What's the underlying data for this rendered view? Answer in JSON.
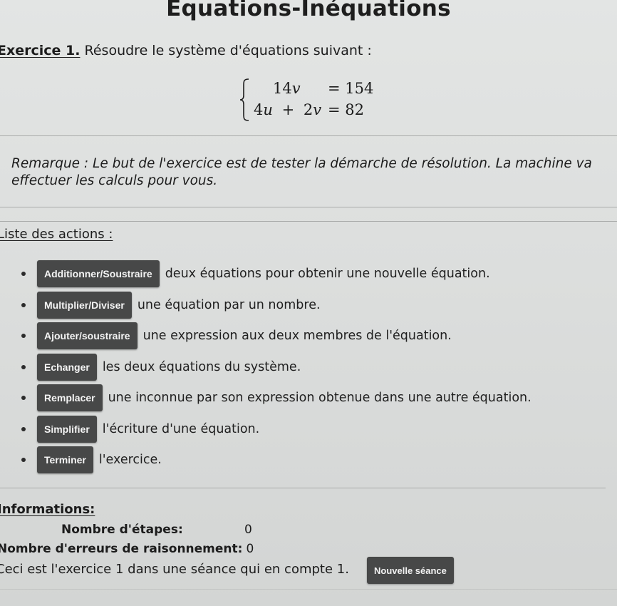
{
  "page": {
    "title": "Equations-Inéquations"
  },
  "exercise": {
    "label": "Exercice 1.",
    "instruction": "Résoudre le système d'équations suivant :",
    "system": {
      "eq1_lhs_coef": "14",
      "eq1_lhs_var": "v",
      "eq1_rhs": "= 154",
      "eq2_term1_coef": "4",
      "eq2_term1_var": "u",
      "eq2_plus": "+",
      "eq2_term2_coef": "2",
      "eq2_term2_var": "v",
      "eq2_rhs": "= 82"
    },
    "note": "Remarque : Le but de l'exercice est de tester la démarche de résolution. La machine va effectuer les calculs pour vous."
  },
  "actions": {
    "heading": "Liste des actions :",
    "items": [
      {
        "button": "Additionner/Soustraire",
        "description": "deux équations pour obtenir une nouvelle équation."
      },
      {
        "button": "Multiplier/Diviser",
        "description": "une équation par un nombre."
      },
      {
        "button": "Ajouter/soustraire",
        "description": "une expression aux deux membres de l'équation."
      },
      {
        "button": "Echanger",
        "description": "les deux équations du système."
      },
      {
        "button": "Remplacer",
        "description": "une inconnue par son expression obtenue dans une autre équation."
      },
      {
        "button": "Simplifier",
        "description": "l'écriture d'une équation."
      },
      {
        "button": "Terminer",
        "description": "l'exercice."
      }
    ]
  },
  "info": {
    "heading": "Informations:",
    "steps_label": "Nombre d'étapes:",
    "steps_value": "0",
    "errors_label": "Nombre d'erreurs de raisonnement:",
    "errors_value": "0",
    "session_text": "Ceci est l'exercice 1 dans une séance qui en compte 1.",
    "new_session_button": "Nouvelle séance"
  }
}
